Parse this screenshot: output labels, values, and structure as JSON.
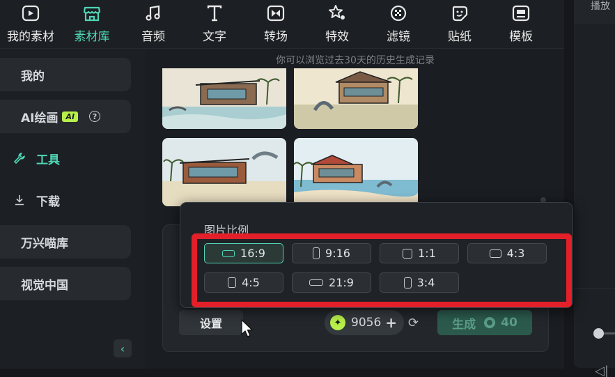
{
  "toolbar": {
    "items": [
      {
        "label": "我的素材",
        "icon": "my-media-icon"
      },
      {
        "label": "素材库",
        "icon": "store-icon",
        "active": true
      },
      {
        "label": "音频",
        "icon": "music-note-icon"
      },
      {
        "label": "文字",
        "icon": "text-icon"
      },
      {
        "label": "转场",
        "icon": "transition-icon"
      },
      {
        "label": "特效",
        "icon": "effects-icon"
      },
      {
        "label": "滤镜",
        "icon": "filter-icon"
      },
      {
        "label": "贴纸",
        "icon": "sticker-icon"
      },
      {
        "label": "模板",
        "icon": "template-icon"
      }
    ]
  },
  "right_panel": {
    "title_partial": "播放"
  },
  "sidebar": {
    "items": [
      {
        "label": "我的"
      },
      {
        "label": "AI绘画",
        "badge": "AI"
      },
      {
        "label": "工具",
        "active": true,
        "icon": "wrench-icon"
      },
      {
        "label": "下载",
        "icon": "download-icon"
      },
      {
        "label": "万兴喵库"
      },
      {
        "label": "视觉中国"
      }
    ],
    "collapse_glyph": "‹"
  },
  "main": {
    "hint": "你可以浏览过去30天的历史生成记录"
  },
  "popup": {
    "title": "图片比例",
    "ratios": [
      {
        "label": "16:9",
        "selected": true
      },
      {
        "label": "9:16"
      },
      {
        "label": "1:1"
      },
      {
        "label": "4:3"
      },
      {
        "label": "4:5"
      },
      {
        "label": "21:9"
      },
      {
        "label": "3:4"
      }
    ]
  },
  "actions": {
    "settings_label": "设置",
    "credits_value": "9056",
    "generate_label": "生成",
    "generate_cost": "40"
  },
  "colors": {
    "accent": "#4fd6b6",
    "highlight": "#e3202a",
    "ai_badge": "#b8f04a"
  }
}
